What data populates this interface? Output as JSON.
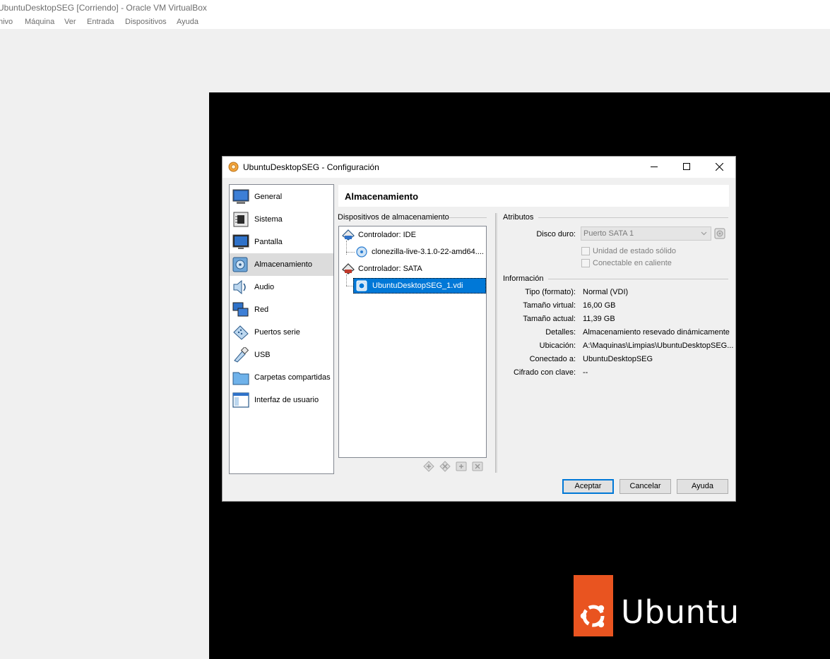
{
  "host": {
    "title": "UbuntuDesktopSEG [Corriendo] - Oracle VM VirtualBox",
    "menu": [
      "hivo",
      "Máquina",
      "Ver",
      "Entrada",
      "Dispositivos",
      "Ayuda"
    ]
  },
  "vm": {
    "logo_text": "Ubuntu",
    "brand_color": "#e95420"
  },
  "dialog": {
    "title": "UbuntuDesktopSEG - Configuración",
    "nav": [
      {
        "label": "General",
        "icon": "general-icon"
      },
      {
        "label": "Sistema",
        "icon": "system-icon"
      },
      {
        "label": "Pantalla",
        "icon": "display-icon"
      },
      {
        "label": "Almacenamiento",
        "icon": "storage-icon",
        "selected": true
      },
      {
        "label": "Audio",
        "icon": "audio-icon"
      },
      {
        "label": "Red",
        "icon": "network-icon"
      },
      {
        "label": "Puertos serie",
        "icon": "serial-port-icon"
      },
      {
        "label": "USB",
        "icon": "usb-icon"
      },
      {
        "label": "Carpetas compartidas",
        "icon": "shared-folder-icon"
      },
      {
        "label": "Interfaz de usuario",
        "icon": "user-interface-icon"
      }
    ],
    "section_title": "Almacenamiento",
    "storage": {
      "group_label": "Dispositivos de almacenamiento",
      "tree": [
        {
          "label": "Controlador: IDE",
          "type": "controller"
        },
        {
          "label": "clonezilla-live-3.1.0-22-amd64....",
          "type": "optical"
        },
        {
          "label": "Controlador: SATA",
          "type": "controller"
        },
        {
          "label": "UbuntuDesktopSEG_1.vdi",
          "type": "disk",
          "selected": true
        }
      ]
    },
    "attributes": {
      "group_label": "Atributos",
      "disk_label": "Disco duro:",
      "disk_value": "Puerto SATA 1",
      "ssd_label": "Unidad de estado sólido",
      "hotplug_label": "Conectable en caliente"
    },
    "info": {
      "group_label": "Información",
      "rows": [
        {
          "label": "Tipo (formato):",
          "value": "Normal (VDI)"
        },
        {
          "label": "Tamaño virtual:",
          "value": "16,00 GB"
        },
        {
          "label": "Tamaño actual:",
          "value": "11,39 GB"
        },
        {
          "label": "Detalles:",
          "value": "Almacenamiento resevado dinámicamente"
        },
        {
          "label": "Ubicación:",
          "value": "A:\\Maquinas\\Limpias\\UbuntuDesktopSEG..."
        },
        {
          "label": "Conectado a:",
          "value": "UbuntuDesktopSEG"
        },
        {
          "label": "Cifrado con clave:",
          "value": "--"
        }
      ]
    },
    "buttons": {
      "accept": "Aceptar",
      "cancel": "Cancelar",
      "help": "Ayuda"
    }
  }
}
